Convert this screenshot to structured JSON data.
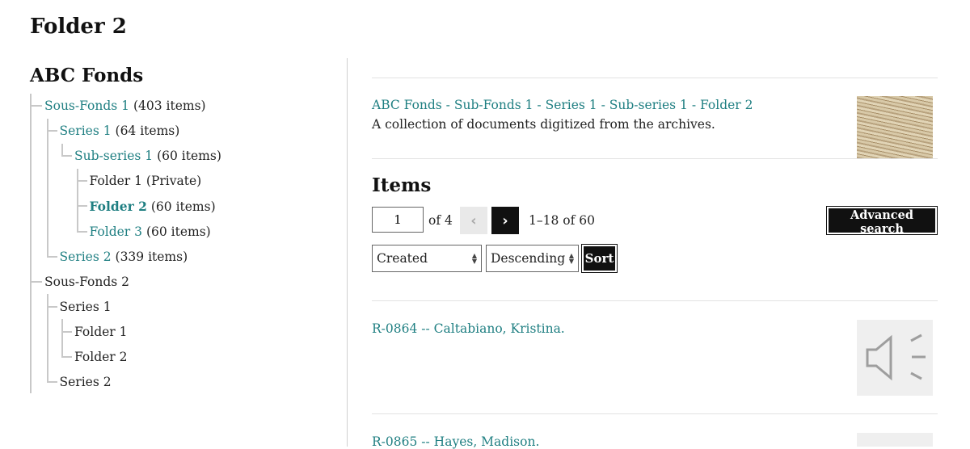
{
  "page": {
    "title": "Folder 2"
  },
  "tree": {
    "title": "ABC Fonds",
    "nodes": [
      {
        "label": "Sous-Fonds 1",
        "count": "(403 items)",
        "level": 0,
        "link": true
      },
      {
        "label": "Series 1",
        "count": "(64 items)",
        "level": 1,
        "link": true
      },
      {
        "label": "Sub-series 1",
        "count": "(60 items)",
        "level": 2,
        "link": true
      },
      {
        "label": "Folder 1 (Private)",
        "count": "",
        "level": 3,
        "link": false
      },
      {
        "label": "Folder 2",
        "count": "(60 items)",
        "level": 3,
        "link": true,
        "current": true
      },
      {
        "label": "Folder 3",
        "count": "(60 items)",
        "level": 3,
        "link": true
      },
      {
        "label": "Series 2",
        "count": "(339 items)",
        "level": 1,
        "link": true
      },
      {
        "label": "Sous-Fonds 2",
        "count": "",
        "level": 0,
        "link": false
      },
      {
        "label": "Series 1",
        "count": "",
        "level": 1,
        "link": false
      },
      {
        "label": "Folder 1",
        "count": "",
        "level": 2,
        "link": false
      },
      {
        "label": "Folder 2",
        "count": "",
        "level": 2,
        "link": false
      },
      {
        "label": "Series 2",
        "count": "",
        "level": 1,
        "link": false
      }
    ]
  },
  "collection": {
    "breadcrumb": "ABC Fonds - Sub-Fonds 1 - Series 1 - Sub-series 1 - Folder 2",
    "description": "A collection of documents digitized from the archives."
  },
  "items": {
    "title": "Items",
    "page_value": "1",
    "of_text": "of 4",
    "prev_icon": "chevron-left-icon",
    "next_icon": "chevron-right-icon",
    "range_text": "1–18 of 60",
    "advanced_search_label": "Advanced search",
    "sort_field": "Created",
    "sort_order": "Descending",
    "sort_label": "Sort"
  },
  "results": [
    {
      "title": "R-0864 -- Caltabiano, Kristina.",
      "icon": "speaker-icon"
    },
    {
      "title": "R-0865 -- Hayes, Madison.",
      "icon": "speaker-icon"
    }
  ],
  "colors": {
    "link": "#1f7f82",
    "button": "#111111",
    "tree_line": "#c8c8c8"
  }
}
